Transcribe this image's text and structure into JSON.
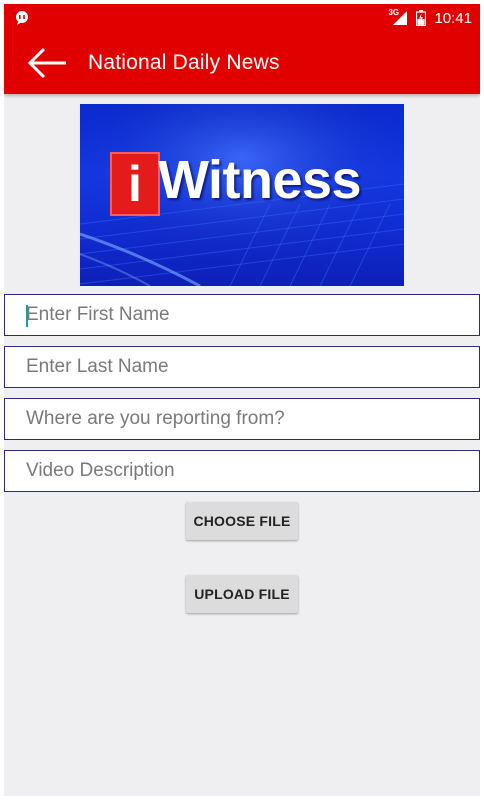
{
  "status_bar": {
    "time": "10:41",
    "network_type": "3G",
    "icons": [
      "notification-icon",
      "signal-icon",
      "battery-icon"
    ]
  },
  "app_bar": {
    "title": "National Daily News",
    "back_icon": "arrow-left-icon",
    "color": "#e00000"
  },
  "banner": {
    "logo_i": "i",
    "logo_word": "Witness"
  },
  "form": {
    "first_name": {
      "value": "",
      "placeholder": "Enter First Name"
    },
    "last_name": {
      "value": "",
      "placeholder": "Enter Last Name"
    },
    "location": {
      "value": "",
      "placeholder": "Where are you reporting from?"
    },
    "description": {
      "value": "",
      "placeholder": "Video Description"
    }
  },
  "buttons": {
    "choose_file": "CHOOSE FILE",
    "upload_file": "UPLOAD FILE"
  }
}
